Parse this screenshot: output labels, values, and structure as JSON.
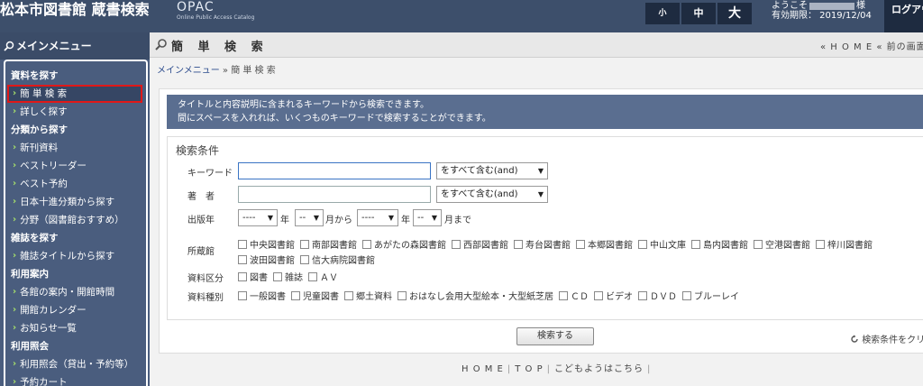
{
  "header": {
    "title": "松本市図書館 蔵書検索",
    "opac": "OPAC",
    "opac_sub": "Online Public Access Catalog",
    "font_sizes": [
      "小",
      "中",
      "大"
    ],
    "welcome": "ようこそ",
    "user_suffix": "様",
    "expiry": "有効期限： 2019/12/04",
    "logout": "ログアウト"
  },
  "sidebar": {
    "title": "メインメニュー",
    "sections": [
      {
        "label": "資料を探す",
        "items": [
          "簡 単 検 索",
          "詳しく探す"
        ]
      },
      {
        "label": "分類から探す",
        "items": [
          "新刊資料",
          "ベストリーダー",
          "ベスト予約",
          "日本十進分類から探す",
          "分野（図書館おすすめ）"
        ]
      },
      {
        "label": "雑誌を探す",
        "items": [
          "雑誌タイトルから探す"
        ]
      },
      {
        "label": "利用案内",
        "items": [
          "各館の案内・開館時間",
          "開館カレンダー",
          "お知らせ一覧"
        ]
      },
      {
        "label": "利用照会",
        "items": [
          "利用照会（貸出・予約等）",
          "予約カート"
        ]
      }
    ]
  },
  "main": {
    "page_title": "簡 単 検 索",
    "toplinks": "« H O M E   « 前の画面に",
    "breadcrumb_link": "メインメニュー",
    "breadcrumb_sep": " » ",
    "breadcrumb_current": "簡 単 検 索",
    "notice_line1": "タイトルと内容説明に含まれるキーワードから検索できます。",
    "notice_line2": "間にスペースを入れれば、いくつものキーワードで検索することができます。",
    "cond_title": "検索条件",
    "keyword_label": "キーワード",
    "keyword_value": "",
    "author_label": "著　者",
    "author_value": "",
    "match_option": "をすべて含む(and)",
    "year_label": "出版年",
    "year_placeholder": "----",
    "month_placeholder": "--",
    "year_unit": "年",
    "month_from": "月から",
    "month_to": "月まで",
    "library_label": "所蔵館",
    "libraries": [
      "中央図書館",
      "南部図書館",
      "あがたの森図書館",
      "西部図書館",
      "寿台図書館",
      "本郷図書館",
      "中山文庫",
      "島内図書館",
      "空港図書館",
      "梓川図書館",
      "波田図書館",
      "信大病院図書館"
    ],
    "material_class_label": "資料区分",
    "material_classes": [
      "図書",
      "雑誌",
      "ＡＶ"
    ],
    "material_type_label": "資料種別",
    "material_types": [
      "一般図書",
      "児童図書",
      "郷土資料",
      "おはなし会用大型絵本・大型紙芝居",
      "ＣＤ",
      "ビデオ",
      "ＤＶＤ",
      "ブルーレイ"
    ],
    "search_button": "検索する",
    "clear_link": "検索条件をクリア"
  },
  "footer": {
    "links": [
      "H O M E",
      "T O P",
      "こどもようはこちら"
    ]
  }
}
